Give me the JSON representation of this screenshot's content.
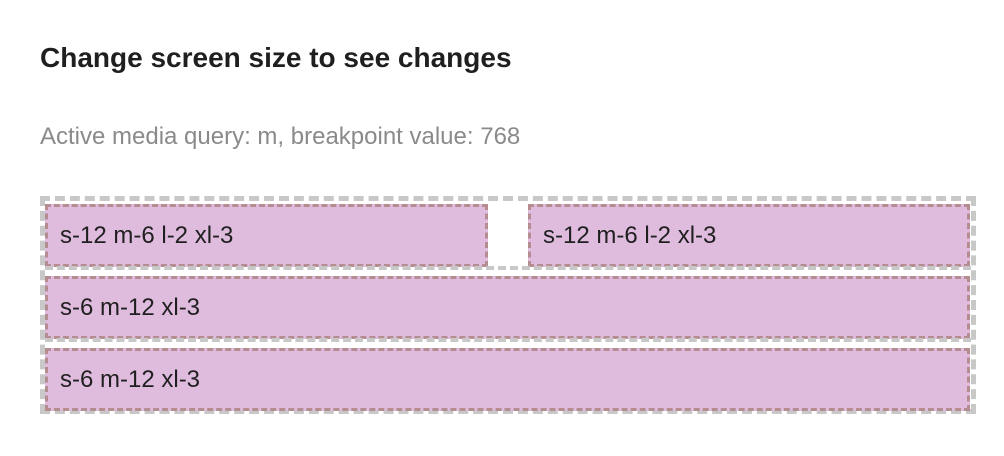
{
  "heading": "Change screen size to see changes",
  "media_query": {
    "label": "Active media query:",
    "name": "m",
    "breakpoint_label": "breakpoint value:",
    "breakpoint_value": "768",
    "full_text": "Active media query: m, breakpoint value: 768"
  },
  "grid": {
    "cells": [
      {
        "label": "s-12 m-6 l-2 xl-3"
      },
      {
        "label": "s-12 m-6 l-2 xl-3"
      },
      {
        "label": "s-6 m-12 xl-3"
      },
      {
        "label": "s-6 m-12 xl-3"
      }
    ]
  },
  "colors": {
    "cell_background": "#dfbcde",
    "cell_border": "#b58d90",
    "container_border": "#c8c8c8",
    "heading_text": "#1f1f1f",
    "muted_text": "#8a8a8a"
  }
}
